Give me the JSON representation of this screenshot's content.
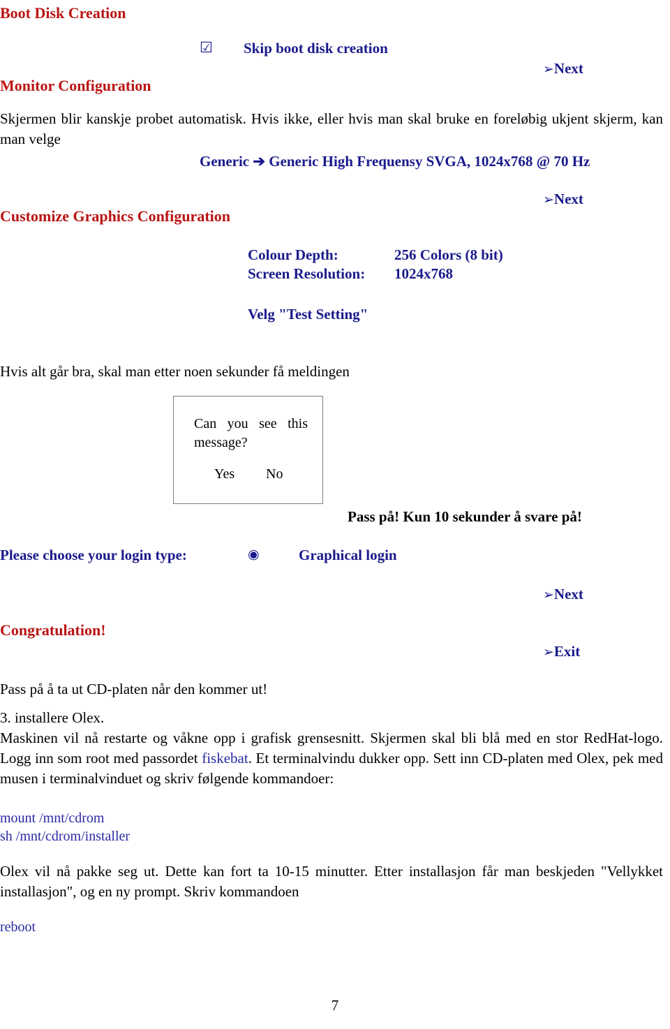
{
  "document": {
    "page_number": "7"
  },
  "sections": {
    "boot_disk": {
      "heading": "Boot Disk Creation",
      "checkbox_glyph": "☑",
      "checkbox_label": "Skip boot disk creation",
      "next_bullet": "➢",
      "next_label": "Next"
    },
    "monitor_config": {
      "heading": "Monitor Configuration",
      "paragraph": "Skjermen blir kanskje probet automatisk. Hvis ikke, eller hvis man skal bruke en foreløbig ukjent skjerm, kan man velge",
      "selection": "Generic ➔ Generic High Frequensy SVGA, 1024x768 @ 70 Hz",
      "next_bullet": "➢",
      "next_label": "Next"
    },
    "customize_graphics": {
      "heading": "Customize Graphics Configuration",
      "settings": [
        {
          "label": "Colour Depth:",
          "value": "256 Colors (8 bit)"
        },
        {
          "label": "Screen Resolution:",
          "value": "1024x768"
        }
      ],
      "action": "Velg \"Test Setting\""
    },
    "test_message": {
      "intro": "Hvis alt går bra, skal man etter noen sekunder få meldingen",
      "dialog": {
        "message": "Can you see this message?",
        "yes_label": "Yes",
        "no_label": "No"
      },
      "warning": "Pass på! Kun 10 sekunder å svare på!"
    },
    "login_type": {
      "prompt": "Please choose your login type:",
      "radio_glyph": "◉",
      "radio_label": "Graphical login",
      "next_bullet": "➢",
      "next_label": "Next"
    },
    "congratulation": {
      "heading": "Congratulation!",
      "exit_bullet": "➢",
      "exit_label": "Exit",
      "note": "Pass på å ta ut CD-platen når den kommer ut!"
    },
    "install_olex": {
      "step_heading": "3. installere Olex.",
      "paragraph_part1": "Maskinen vil nå restarte og våkne opp i grafisk grensesnitt. Skjermen skal bli blå med en stor RedHat-logo. Logg inn som root med passordet ",
      "password": "fiskebat",
      "paragraph_part2": ". Et terminalvindu dukker opp. Sett inn CD-platen med Olex, pek med musen i terminalvinduet og skriv følgende kommandoer:",
      "commands": [
        "mount /mnt/cdrom",
        "sh /mnt/cdrom/installer"
      ],
      "closing_paragraph": "Olex vil nå pakke seg ut. Dette kan fort ta 10-15 minutter. Etter installasjon får man beskjeden \"Vellykket installasjon\", og en ny prompt. Skriv kommandoen",
      "final_command": "reboot"
    }
  },
  "colors": {
    "heading_red": "#BB1414",
    "accent_blue": "#1A1A8C",
    "link_blue": "#2A2AA5",
    "body_black": "#000000",
    "dialog_border": "#808080"
  }
}
